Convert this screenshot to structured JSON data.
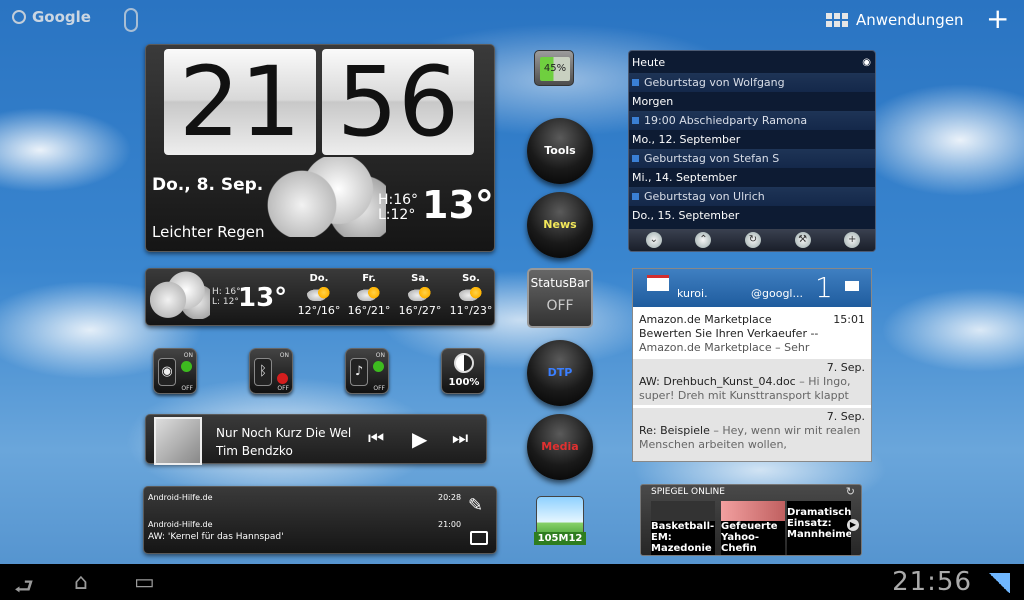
{
  "topbar": {
    "search_label": "Google",
    "apps_label": "Anwendungen",
    "add_label": "+"
  },
  "clock": {
    "hour": "21",
    "minute": "56",
    "date": "Do., 8. Sep.",
    "condition": "Leichter Regen",
    "high": "H:16°",
    "low": "L:12°",
    "temp": "13°"
  },
  "forecast": {
    "high": "H: 16°",
    "low": "L: 12°",
    "temp": "13°",
    "days": [
      {
        "name": "Do.",
        "range": "12°/16°"
      },
      {
        "name": "Fr.",
        "range": "16°/21°"
      },
      {
        "name": "Sa.",
        "range": "16°/27°"
      },
      {
        "name": "So.",
        "range": "11°/23°"
      }
    ]
  },
  "toggles": {
    "wifi_on": "ON",
    "wifi_off": "OFF",
    "bt_on": "ON",
    "bt_off": "OFF",
    "sound_on": "ON",
    "sound_off": "OFF",
    "brightness": "100%"
  },
  "music": {
    "title": "Nur Noch Kurz Die Welt",
    "artist": "Tim Bendzko",
    "prev": "⏮",
    "play": "▶",
    "next": "⏭"
  },
  "messages": [
    {
      "source": "Android-Hilfe.de",
      "time": "20:28",
      "text": ""
    },
    {
      "source": "Android-Hilfe.de",
      "time": "21:00",
      "text": "AW: 'Kernel für das Hannspad'"
    }
  ],
  "middle": {
    "battery": "45%",
    "tools": "Tools",
    "news": "News",
    "statusbar_title": "StatusBar",
    "statusbar_state": "OFF",
    "dtp": "DTP",
    "media": "Media",
    "temp_widget": "105M12"
  },
  "calendar": {
    "rows": [
      {
        "type": "header",
        "text": "Heute"
      },
      {
        "type": "event",
        "text": "Geburtstag von Wolfgang"
      },
      {
        "type": "header",
        "text": "Morgen"
      },
      {
        "type": "event",
        "text": "19:00  Abschiedparty Ramona"
      },
      {
        "type": "header",
        "text": "Mo., 12. September"
      },
      {
        "type": "event",
        "text": "Geburtstag von Stefan S"
      },
      {
        "type": "header",
        "text": "Mi., 14. September"
      },
      {
        "type": "event",
        "text": "Geburtstag von Ulrich"
      },
      {
        "type": "header",
        "text": "Do., 15. September"
      }
    ]
  },
  "gmail": {
    "account": "kuroi.",
    "domain": "@googl...",
    "count": "1",
    "messages": [
      {
        "from": "Amazon.de Marketplace",
        "time": "15:01",
        "subject": "Bewerten Sie Ihren Verkaeufer --",
        "preview": "Amazon.de Marketplace – Sehr"
      },
      {
        "from": "",
        "time": "7. Sep.",
        "subject": "AW: Drehbuch_Kunst_04.doc",
        "preview": "– Hi Ingo, super! Dreh mit Kunsttransport klappt"
      },
      {
        "from": "",
        "time": "7. Sep.",
        "subject": "Re: Beispiele",
        "preview": "– Hey, wenn wir mit realen Menschen arbeiten wollen,"
      }
    ]
  },
  "spiegel": {
    "title": "SPIEGEL ONLINE",
    "items": [
      "Basketball-EM: Mazedonie",
      "Gefeuerte Yahoo-Chefin",
      "Dramatischer Einsatz: Mannheimer"
    ]
  },
  "navbar": {
    "time": "21:56"
  }
}
